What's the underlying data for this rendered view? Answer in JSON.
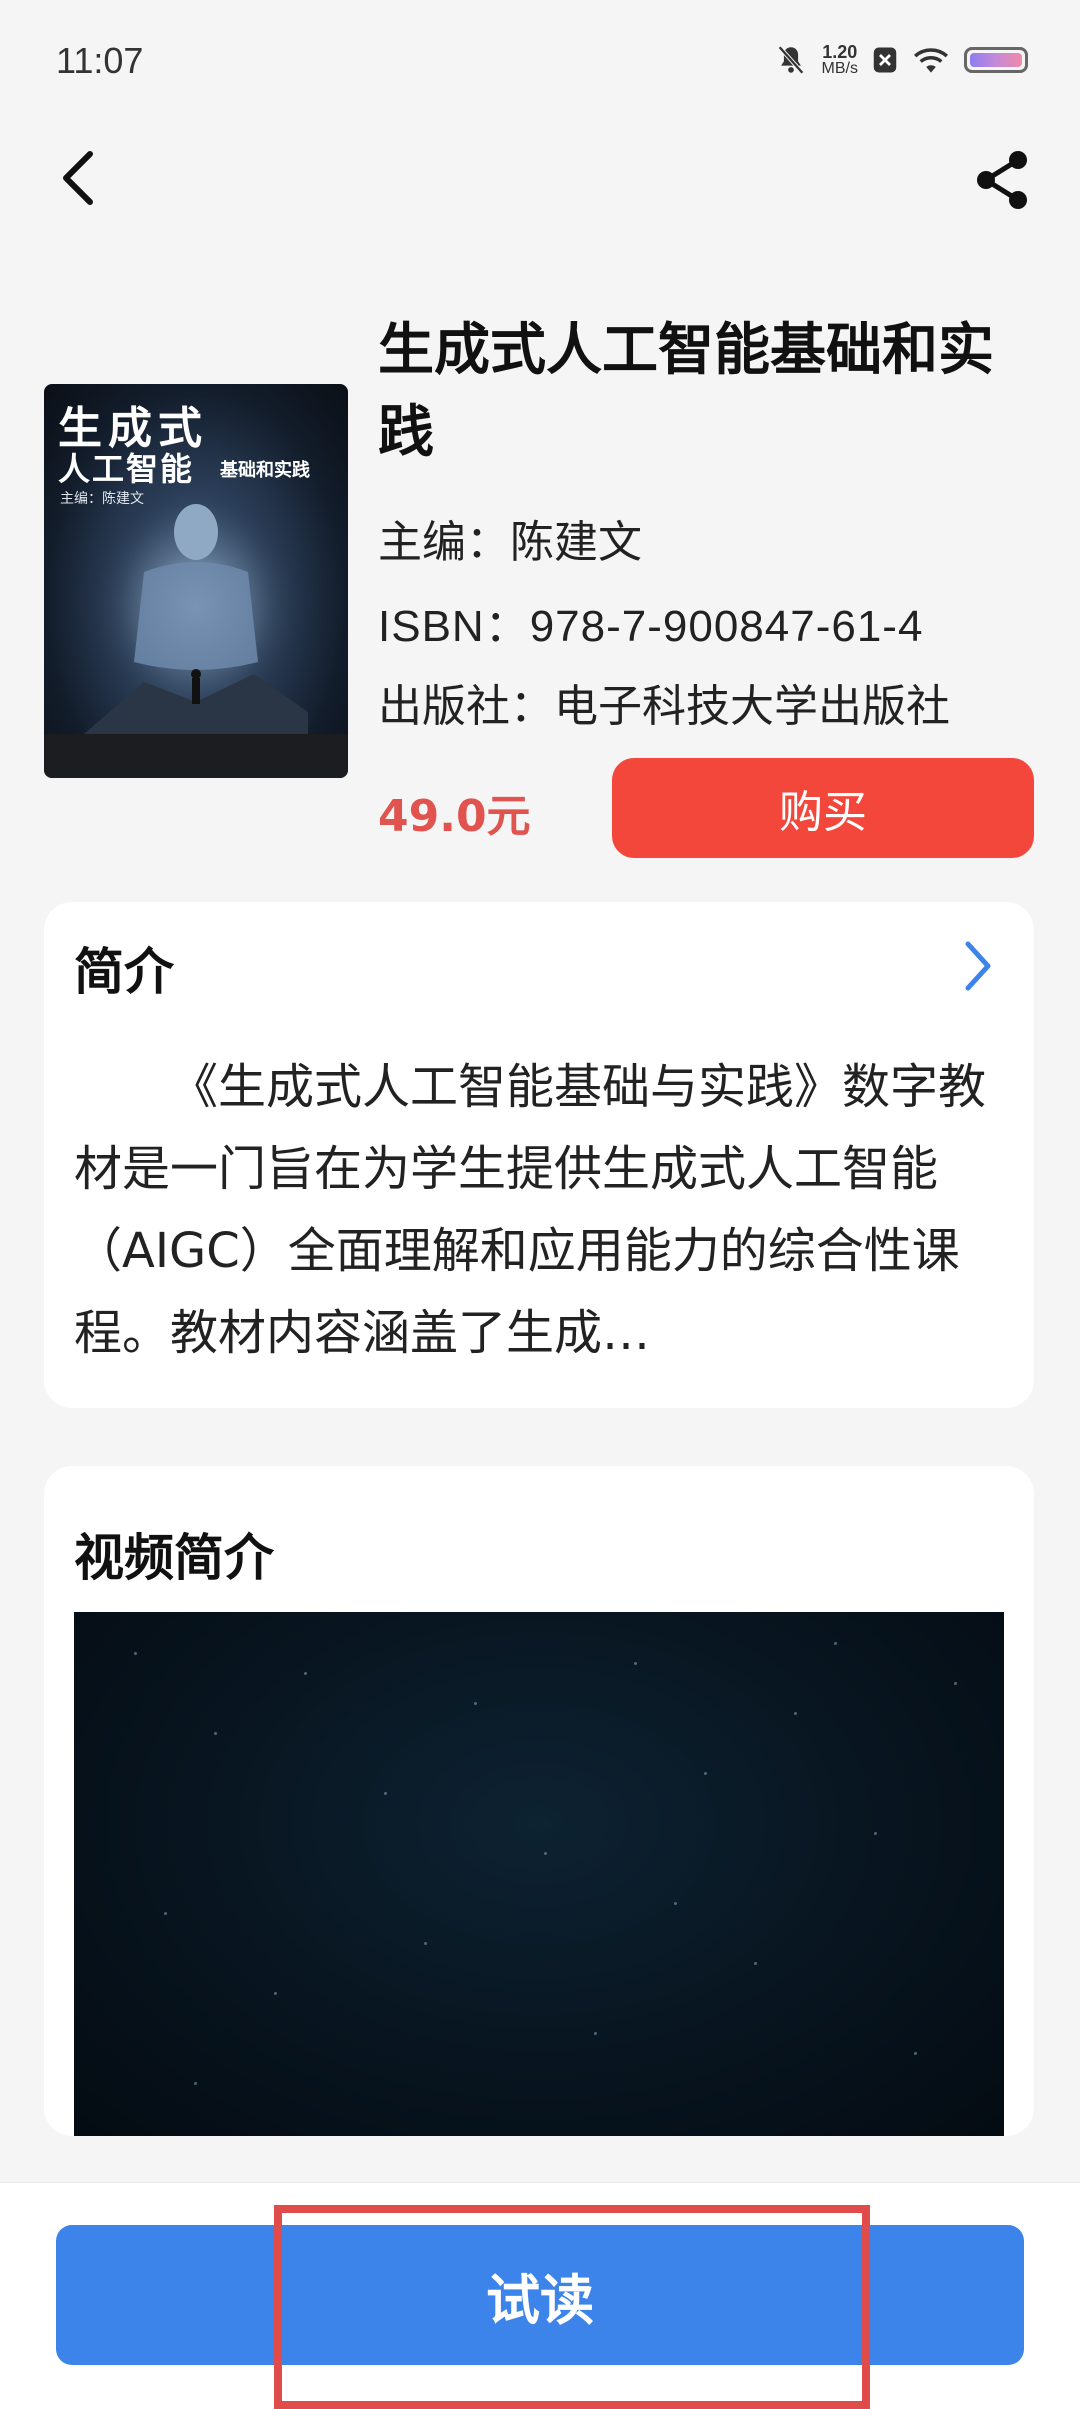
{
  "status_bar": {
    "time": "11:07",
    "net_speed_value": "1.20",
    "net_speed_unit": "MB/s",
    "icons": [
      "mute-bell-icon",
      "close-box-icon",
      "wifi-icon",
      "battery-icon"
    ]
  },
  "nav": {
    "back_icon": "chevron-left-icon",
    "share_icon": "share-icon"
  },
  "book": {
    "title": "生成式人工智能基础和实践",
    "editor": "主编：陈建文",
    "isbn": "ISBN：978-7-900847-61-4",
    "publisher": "出版社：电子科技大学出版社",
    "price": "49.0元",
    "buy_label": "购买",
    "cover": {
      "title_line1": "生成式",
      "title_line2": "人工智能",
      "title_line3": "基础和实践",
      "author": "主编：陈建文"
    }
  },
  "intro": {
    "heading": "简介",
    "text": "《生成式人工智能基础与实践》数字教材是一门旨在为学生提供生成式人工智能（AIGC）全面理解和应用能力的综合性课程。教材内容涵盖了生成…"
  },
  "video": {
    "heading": "视频简介"
  },
  "bottom": {
    "trial_label": "试读"
  },
  "colors": {
    "buy": "#f4473b",
    "price": "#e0534f",
    "trial": "#3c83ea",
    "highlight": "#e04b4b",
    "link_arrow": "#3c83ea"
  }
}
